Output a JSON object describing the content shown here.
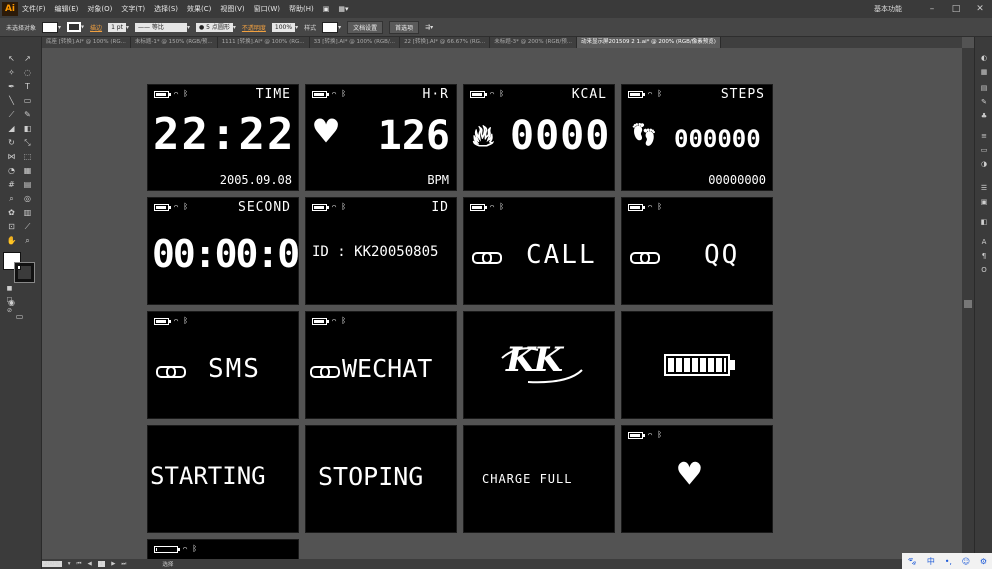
{
  "app": {
    "logo": "Ai"
  },
  "menu": [
    "文件(F)",
    "编辑(E)",
    "对象(O)",
    "文字(T)",
    "选择(S)",
    "效果(C)",
    "视图(V)",
    "窗口(W)",
    "帮助(H)"
  ],
  "workspace": "基本功能",
  "control_bar": {
    "selection": "未选择对象",
    "stroke_label": "描边",
    "stroke_value": "1 pt",
    "profile": "等比",
    "brush": "5 点圆形",
    "opacity_label": "不透明度",
    "opacity_value": "100%",
    "style_label": "样式",
    "doc_setup": "文档设置",
    "preferences": "首选项"
  },
  "tabs": [
    "底座 [转换].AI* @ 100% (RG...",
    "未标题-1* @ 150% (RGB/预...",
    "1111 [转换].AI* @ 100% (RG...",
    "33 [转换].AI* @ 100% (RGB/...",
    "22 [转换].AI* @ 66.67% (RG...",
    "未标题-3* @ 200% (RGB/预...",
    "动来显示屏201509 2 1.ai* @ 200% (RGB/像素预览)"
  ],
  "status": {
    "zoom": "200%",
    "artboard": "1",
    "mode": "选择"
  },
  "ime": [
    "中",
    "•,",
    "☺",
    "⚙"
  ],
  "screens": {
    "time": {
      "label": "TIME",
      "value": "22:22",
      "date": "2005.09.08"
    },
    "hr": {
      "label": "H·R",
      "value": "126",
      "unit": "BPM"
    },
    "kcal": {
      "label": "KCAL",
      "value": "0000"
    },
    "steps": {
      "label": "STEPS",
      "value": "000000",
      "sub": "00000000"
    },
    "second": {
      "label": "SECOND",
      "value": "00:00:0"
    },
    "id": {
      "label": "ID",
      "value": "ID : KK20050805"
    },
    "call": {
      "value": "CALL"
    },
    "qq": {
      "value": "QQ"
    },
    "sms": {
      "value": "SMS"
    },
    "wechat": {
      "value": "WECHAT"
    },
    "logo": {
      "value": "KK"
    },
    "starting": {
      "value": "STARTING"
    },
    "stoping": {
      "value": "STOPING"
    },
    "charge": {
      "value": "CHARGE FULL"
    }
  }
}
